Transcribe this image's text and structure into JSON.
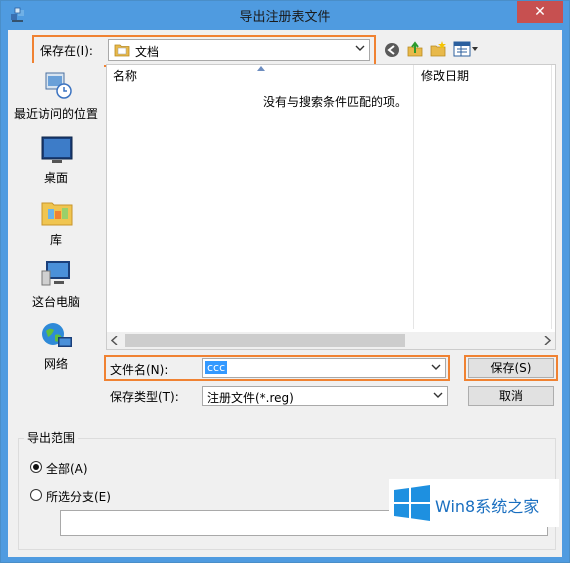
{
  "window": {
    "title": "导出注册表文件",
    "close_glyph": "✕"
  },
  "toolbar": {
    "save_in_label": "保存在(I):",
    "save_in_value": "文档"
  },
  "places": [
    {
      "label": "最近访问的位置",
      "icon": "recent-places-icon"
    },
    {
      "label": "桌面",
      "icon": "desktop-icon"
    },
    {
      "label": "库",
      "icon": "libraries-icon"
    },
    {
      "label": "这台电脑",
      "icon": "this-pc-icon"
    },
    {
      "label": "网络",
      "icon": "network-icon"
    }
  ],
  "filelist": {
    "columns": [
      "名称",
      "修改日期"
    ],
    "empty_text": "没有与搜索条件匹配的项。"
  },
  "form": {
    "filename_label": "文件名(N):",
    "filename_value": "ccc",
    "filetype_label": "保存类型(T):",
    "filetype_value": "注册文件(*.reg)",
    "save_button": "保存(S)",
    "cancel_button": "取消"
  },
  "export_range": {
    "title": "导出范围",
    "all_label": "全部(A)",
    "selected_label": "所选分支(E)",
    "selected_branch_value": ""
  },
  "watermark": {
    "text": "Win8系统之家"
  },
  "colors": {
    "accent": "#4f9be0",
    "highlight": "#f08232",
    "selection": "#3399ff"
  }
}
